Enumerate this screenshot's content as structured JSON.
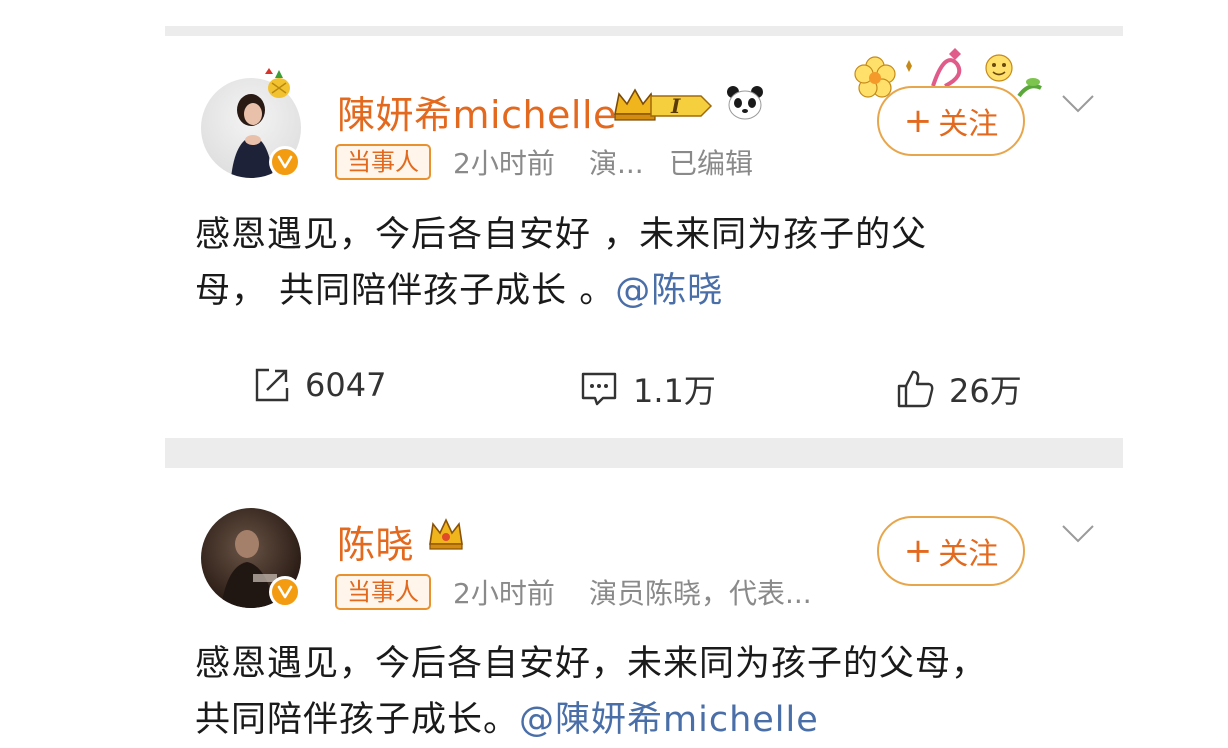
{
  "post1": {
    "username": "陳妍希michelle",
    "level_badge": "I",
    "icons": [
      "crown-level-icon",
      "panda-icon",
      "verified-v-icon",
      "flower-sticker-icon"
    ],
    "tag": "当事人",
    "time": "2小时前",
    "source": "演...",
    "edited": "已编辑",
    "follow_label": "关注",
    "content_line1": "感恩遇见，今后各自安好 ，未来同为孩子的父",
    "content_line2": "母， 共同陪伴孩子成长 。",
    "mention": "@陈晓",
    "repost_count": "6047",
    "comment_count": "1.1万",
    "like_count": "26万"
  },
  "post2": {
    "username": "陈晓",
    "icons": [
      "crown-icon",
      "verified-v-icon"
    ],
    "tag": "当事人",
    "time": "2小时前",
    "source": "演员陈晓，代表...",
    "follow_label": "关注",
    "content_line1": "感恩遇见，今后各自安好，未来同为孩子的父母，",
    "content_line2": "共同陪伴孩子成长。",
    "mention": "@陳妍希michelle"
  },
  "colors": {
    "accent_orange": "#e3691e",
    "mention_blue": "#4a6fa8",
    "meta_gray": "#8a8a8a",
    "divider_gray": "#ececec"
  }
}
